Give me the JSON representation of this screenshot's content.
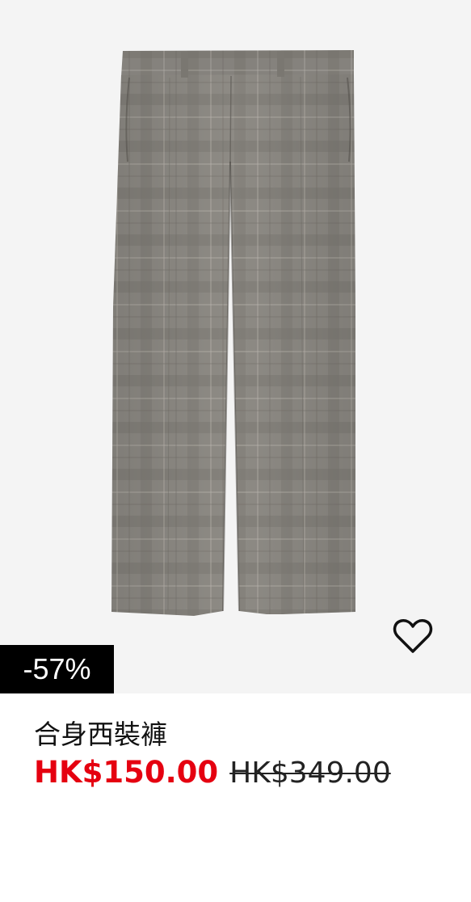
{
  "product": {
    "image_alt": "Checked tailored trousers",
    "discount_badge": "-57%",
    "title": "合身西裝褲",
    "sale_price": "HK$150.00",
    "original_price": "HK$349.00",
    "wishlist_icon": "heart-icon",
    "colors": {
      "sale_price": "#e50010",
      "badge_background": "#000000",
      "badge_text": "#ffffff",
      "fabric": "#8f8c86"
    }
  }
}
